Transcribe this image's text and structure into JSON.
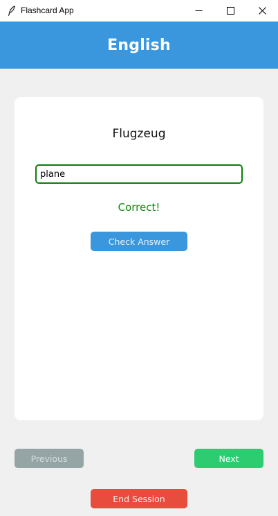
{
  "window": {
    "title": "Flashcard App",
    "app_icon": "feather-quill-icon"
  },
  "header": {
    "title": "English",
    "background_color": "#3b97dd"
  },
  "card": {
    "word": "Flugzeug",
    "answer_value": "plane",
    "feedback": "Correct!",
    "feedback_color": "#0f8a0f",
    "check_button_label": "Check Answer"
  },
  "navigation": {
    "previous_label": "Previous",
    "next_label": "Next",
    "end_session_label": "End Session"
  },
  "colors": {
    "accent": "#3b97dd",
    "next": "#2ecc71",
    "previous": "#95a5a6",
    "end": "#e74c3c"
  }
}
